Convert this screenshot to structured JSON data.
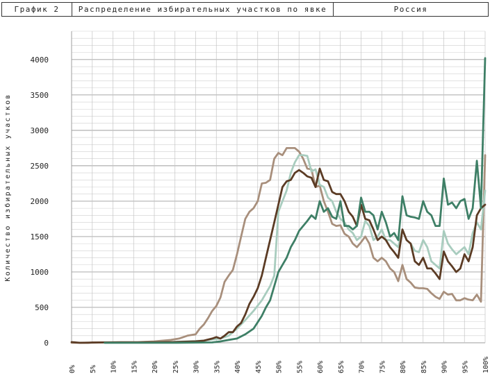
{
  "header": {
    "cell1": "График 2",
    "cell2": "Распределение избирательных участков по явке",
    "cell3": "Россия"
  },
  "chart_data": {
    "type": "line",
    "ylabel": "Количество избирательных участков",
    "xlabel": "",
    "xlim": [
      0,
      100
    ],
    "ylim": [
      0,
      4400
    ],
    "yticks": [
      0,
      500,
      1000,
      1500,
      2000,
      2500,
      3000,
      3500,
      4000
    ],
    "xticks": [
      0,
      5,
      10,
      15,
      20,
      25,
      30,
      35,
      40,
      45,
      50,
      55,
      60,
      65,
      70,
      75,
      80,
      85,
      90,
      95,
      100
    ],
    "xtick_labels": [
      "0%",
      "5%",
      "10%",
      "15%",
      "20%",
      "25%",
      "30%",
      "35%",
      "40%",
      "45%",
      "50%",
      "55%",
      "60%",
      "65%",
      "70%",
      "75%",
      "80%",
      "85%",
      "90%",
      "95%",
      "100%"
    ],
    "grid": true,
    "colors": {
      "tan": "#a88f7c",
      "light_green": "#a8ccbe",
      "dark_brown": "#5b3b24",
      "green": "#3e7f66"
    },
    "series": [
      {
        "color": "#a88f7c",
        "x": [
          0,
          4,
          5,
          8,
          12,
          16,
          20,
          24,
          26,
          28,
          30,
          31,
          32,
          33,
          34,
          35,
          36,
          37,
          38,
          39,
          40,
          41,
          42,
          43,
          44,
          45,
          46,
          47,
          48,
          49,
          50,
          51,
          52,
          53,
          54,
          55,
          56,
          57,
          58,
          59,
          60,
          61,
          62,
          63,
          64,
          65,
          66,
          67,
          68,
          69,
          70,
          71,
          72,
          73,
          74,
          75,
          76,
          77,
          78,
          79,
          80,
          81,
          82,
          83,
          84,
          85,
          86,
          87,
          88,
          89,
          90,
          91,
          92,
          93,
          94,
          95,
          96,
          97,
          98,
          99,
          100
        ],
        "values": [
          0,
          0,
          5,
          5,
          10,
          10,
          20,
          40,
          60,
          100,
          120,
          200,
          260,
          350,
          450,
          520,
          640,
          860,
          950,
          1030,
          1250,
          1500,
          1750,
          1850,
          1900,
          2000,
          2250,
          2260,
          2300,
          2600,
          2680,
          2650,
          2750,
          2750,
          2750,
          2700,
          2600,
          2460,
          2450,
          2200,
          2220,
          2000,
          1850,
          1680,
          1650,
          1660,
          1540,
          1500,
          1400,
          1350,
          1420,
          1500,
          1400,
          1200,
          1150,
          1200,
          1150,
          1050,
          1000,
          870,
          1100,
          900,
          850,
          780,
          770,
          770,
          760,
          700,
          650,
          620,
          720,
          680,
          690,
          600,
          600,
          630,
          610,
          600,
          680,
          580,
          2650
        ]
      },
      {
        "color": "#a8ccbe",
        "x": [
          8,
          16,
          24,
          32,
          36,
          38,
          40,
          42,
          44,
          46,
          48,
          49,
          50,
          51,
          52,
          53,
          54,
          55,
          56,
          57,
          58,
          59,
          60,
          61,
          62,
          63,
          64,
          65,
          66,
          67,
          68,
          69,
          70,
          71,
          72,
          73,
          74,
          75,
          76,
          77,
          78,
          79,
          80,
          81,
          82,
          83,
          84,
          85,
          86,
          87,
          88,
          89,
          90,
          91,
          92,
          93,
          94,
          95,
          96,
          97,
          98,
          99,
          100
        ],
        "values": [
          0,
          5,
          10,
          30,
          60,
          100,
          200,
          320,
          450,
          600,
          800,
          950,
          1850,
          2000,
          2150,
          2400,
          2550,
          2650,
          2650,
          2640,
          2420,
          2450,
          2230,
          2200,
          2050,
          2000,
          1850,
          1750,
          1700,
          1600,
          1550,
          1450,
          1500,
          1720,
          1650,
          1450,
          1500,
          1600,
          1450,
          1450,
          1400,
          1350,
          1600,
          1450,
          1400,
          1300,
          1280,
          1450,
          1350,
          1150,
          1100,
          1050,
          1580,
          1400,
          1320,
          1250,
          1300,
          1350,
          1250,
          1550,
          1700,
          1600,
          2150
        ]
      },
      {
        "color": "#5b3b24",
        "x": [
          0,
          2,
          8,
          16,
          24,
          30,
          32,
          34,
          35,
          36,
          37,
          38,
          39,
          40,
          41,
          42,
          43,
          44,
          45,
          46,
          47,
          48,
          49,
          50,
          51,
          52,
          53,
          54,
          55,
          56,
          57,
          58,
          59,
          60,
          61,
          62,
          63,
          64,
          65,
          66,
          67,
          68,
          69,
          70,
          71,
          72,
          73,
          74,
          75,
          76,
          77,
          78,
          79,
          80,
          81,
          82,
          83,
          84,
          85,
          86,
          87,
          88,
          89,
          90,
          91,
          92,
          93,
          94,
          95,
          96,
          97,
          98,
          99,
          100
        ],
        "values": [
          10,
          0,
          5,
          5,
          10,
          20,
          30,
          60,
          80,
          60,
          100,
          150,
          150,
          230,
          280,
          400,
          550,
          650,
          770,
          950,
          1200,
          1450,
          1700,
          1950,
          2200,
          2280,
          2300,
          2400,
          2440,
          2400,
          2350,
          2330,
          2200,
          2460,
          2300,
          2280,
          2130,
          2100,
          2100,
          2000,
          1850,
          1780,
          1650,
          1950,
          1750,
          1730,
          1600,
          1450,
          1500,
          1450,
          1350,
          1280,
          1200,
          1600,
          1450,
          1400,
          1150,
          1100,
          1200,
          1050,
          1050,
          980,
          900,
          1290,
          1150,
          1080,
          1000,
          1050,
          1250,
          1150,
          1350,
          1800,
          1900,
          1950
        ]
      },
      {
        "color": "#3e7f66",
        "x": [
          8,
          16,
          24,
          34,
          36,
          38,
          40,
          42,
          44,
          46,
          47,
          48,
          49,
          50,
          51,
          52,
          53,
          54,
          55,
          56,
          57,
          58,
          59,
          60,
          61,
          62,
          63,
          64,
          65,
          66,
          67,
          68,
          69,
          70,
          71,
          72,
          73,
          74,
          75,
          76,
          77,
          78,
          79,
          80,
          81,
          82,
          83,
          84,
          85,
          86,
          87,
          88,
          89,
          90,
          91,
          92,
          93,
          94,
          95,
          96,
          97,
          98,
          99,
          100
        ],
        "values": [
          0,
          0,
          0,
          5,
          20,
          40,
          60,
          120,
          200,
          380,
          500,
          600,
          800,
          1000,
          1100,
          1200,
          1350,
          1450,
          1580,
          1650,
          1720,
          1800,
          1750,
          2000,
          1850,
          1900,
          1780,
          1750,
          2000,
          1650,
          1650,
          1600,
          1650,
          2050,
          1850,
          1850,
          1800,
          1600,
          1850,
          1700,
          1500,
          1550,
          1450,
          2070,
          1800,
          1780,
          1770,
          1750,
          2000,
          1850,
          1800,
          1650,
          1650,
          2320,
          1950,
          1980,
          1900,
          2000,
          2030,
          1750,
          1900,
          2570,
          1900,
          4020
        ]
      }
    ]
  }
}
